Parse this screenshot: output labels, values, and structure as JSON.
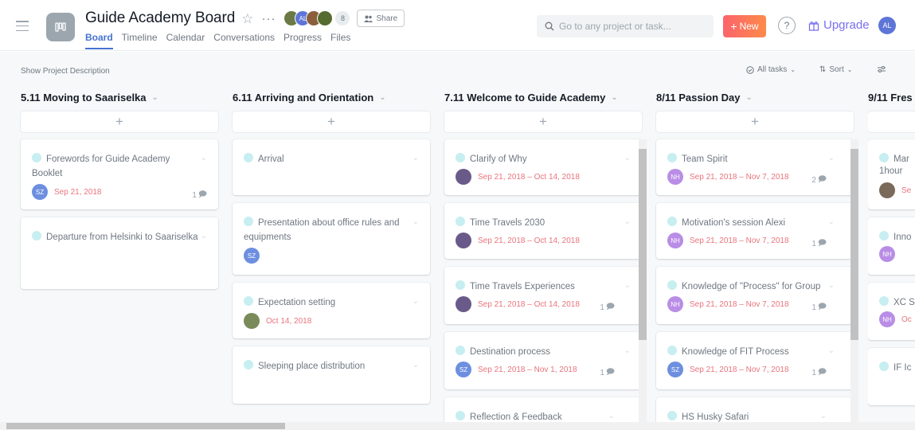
{
  "header": {
    "project_title": "Guide Academy Board",
    "member_count": "8",
    "share_label": "Share",
    "tabs": [
      "Board",
      "Timeline",
      "Calendar",
      "Conversations",
      "Progress",
      "Files"
    ],
    "search_placeholder": "Go to any project or task...",
    "new_label": "New",
    "help_label": "?",
    "upgrade_label": "Upgrade",
    "user_initials": "AL",
    "members": [
      {
        "initials": "",
        "color": "#6b7a45"
      },
      {
        "initials": "AL",
        "color": "#5d75d7"
      },
      {
        "initials": "",
        "color": "#8b5e3c"
      },
      {
        "initials": "",
        "color": "#556b2f"
      }
    ]
  },
  "toolbar": {
    "show_description": "Show Project Description",
    "all_tasks": "All tasks",
    "sort": "Sort"
  },
  "colors": {
    "accent": "#4573d2",
    "due": "#e8747c",
    "check": "#c7eef0"
  },
  "columns": [
    {
      "title": "5.11 Moving to Saariselka",
      "cards": [
        {
          "title": "Forewords for Guide Academy Booklet",
          "avatar": "SZ",
          "avatar_color": "#6d8fe0",
          "due": "Sep 21, 2018",
          "comments": "1"
        },
        {
          "title": "Departure from Helsinki to Saariselka",
          "avatar": "",
          "due": "",
          "comments": ""
        }
      ]
    },
    {
      "title": "6.11 Arriving and Orientation",
      "cards": [
        {
          "title": "Arrival",
          "avatar": "",
          "due": "",
          "comments": ""
        },
        {
          "title": "Presentation about office rules and equipments",
          "avatar": "SZ",
          "avatar_color": "#6d8fe0",
          "due": "",
          "comments": ""
        },
        {
          "title": "Expectation setting",
          "avatar": "photo",
          "avatar_color": "#7a8a5a",
          "due": "Oct 14, 2018",
          "comments": ""
        },
        {
          "title": "Sleeping place distribution",
          "avatar": "",
          "due": "",
          "comments": ""
        }
      ]
    },
    {
      "title": "7.11 Welcome to Guide Academy",
      "cards": [
        {
          "title": "Clarify of Why",
          "avatar": "photo",
          "avatar_color": "#6a5a8a",
          "due": "Sep 21, 2018 – Oct 14, 2018",
          "comments": ""
        },
        {
          "title": "Time Travels 2030",
          "avatar": "photo",
          "avatar_color": "#6a5a8a",
          "due": "Sep 21, 2018 – Oct 14, 2018",
          "comments": ""
        },
        {
          "title": "Time Travels Experiences",
          "avatar": "photo",
          "avatar_color": "#6a5a8a",
          "due": "Sep 21, 2018 – Oct 14, 2018",
          "comments": "1"
        },
        {
          "title": "Destination process",
          "avatar": "SZ",
          "avatar_color": "#6d8fe0",
          "due": "Sep 21, 2018 – Nov 1, 2018",
          "comments": "1"
        },
        {
          "title": "Reflection & Feedback",
          "avatar": "",
          "due": "",
          "comments": ""
        }
      ]
    },
    {
      "title": "8/11 Passion Day",
      "cards": [
        {
          "title": "Team Spirit",
          "avatar": "NH",
          "avatar_color": "#b98de6",
          "due": "Sep 21, 2018 – Nov 7, 2018",
          "comments": "2"
        },
        {
          "title": "Motivation's session Alexi",
          "avatar": "NH",
          "avatar_color": "#b98de6",
          "due": "Sep 21, 2018 – Nov 7, 2018",
          "comments": "1"
        },
        {
          "title": "Knowledge of \"Process\" for Group",
          "avatar": "NH",
          "avatar_color": "#b98de6",
          "due": "Sep 21, 2018 – Nov 7, 2018",
          "comments": "1"
        },
        {
          "title": "Knowledge of FIT Process",
          "avatar": "SZ",
          "avatar_color": "#6d8fe0",
          "due": "Sep 21, 2018 – Nov 7, 2018",
          "comments": "1"
        },
        {
          "title": "HS Husky Safari",
          "avatar": "",
          "due": "",
          "comments": ""
        }
      ]
    },
    {
      "title": "9/11 Fres",
      "cards": [
        {
          "title": "Mar",
          "subtitle": "1hour",
          "avatar": "photo",
          "avatar_color": "#7a6a5a",
          "due": "Se",
          "comments": ""
        },
        {
          "title": "Inno",
          "avatar": "NH",
          "avatar_color": "#b98de6",
          "due": "",
          "comments": ""
        },
        {
          "title": "XC S",
          "avatar": "NH",
          "avatar_color": "#b98de6",
          "due": "Oc",
          "comments": ""
        },
        {
          "title": "IF Ic",
          "avatar": "",
          "due": "",
          "comments": ""
        }
      ]
    }
  ]
}
